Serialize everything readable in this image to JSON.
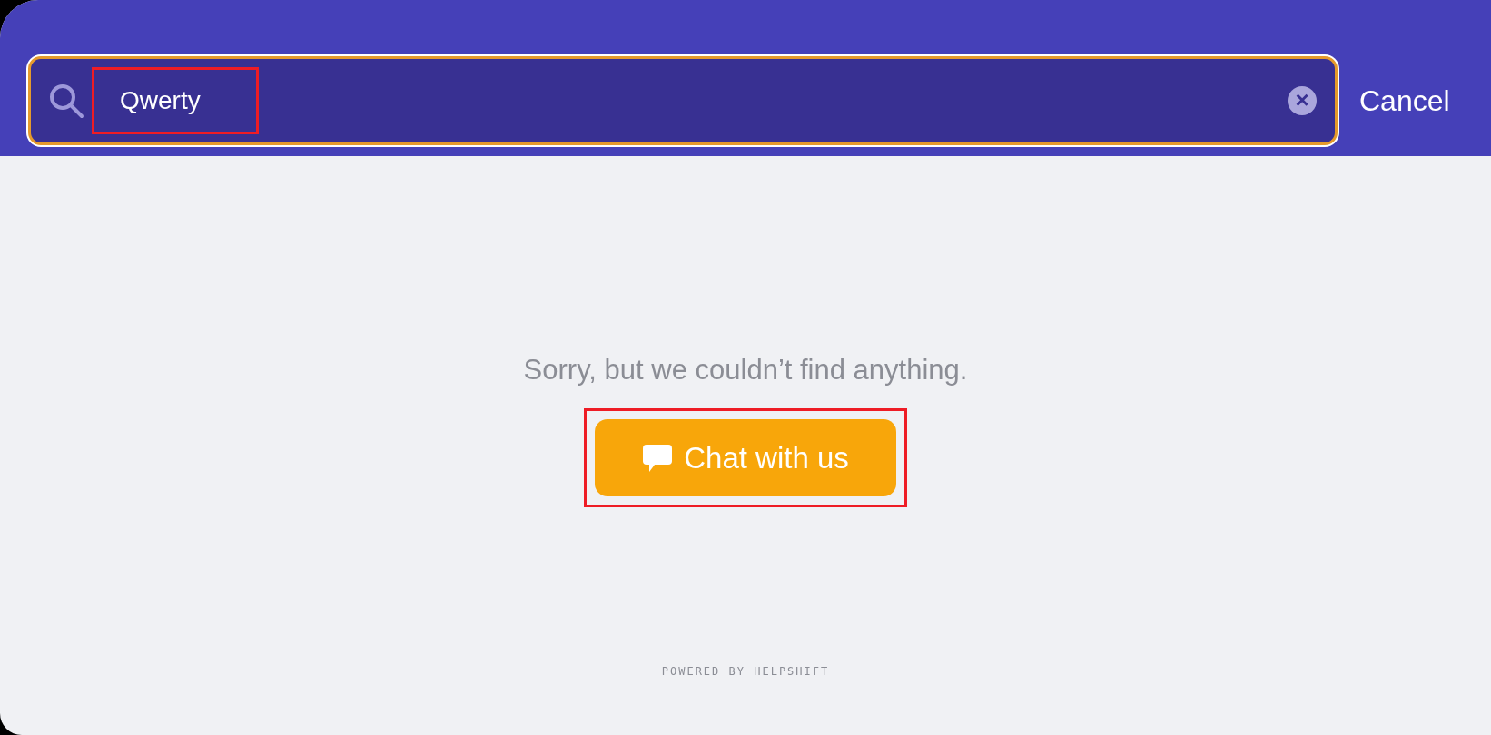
{
  "search": {
    "value": "Qwerty",
    "value_highlighted": true,
    "clear_icon": "×"
  },
  "cancel": "Cancel",
  "message": "Sorry, but we couldn’t find anything.",
  "chat_button": {
    "label": "Chat with us",
    "highlighted": true
  },
  "footer": "POWERED BY HELPSHIFT"
}
